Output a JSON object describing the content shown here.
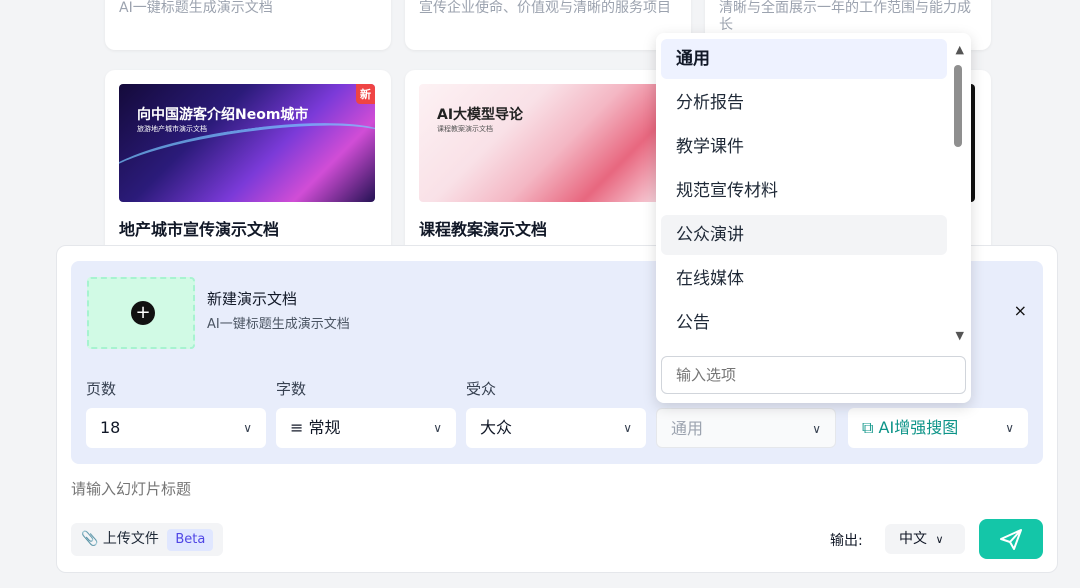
{
  "top_cards": [
    {
      "desc": "AI一键标题生成演示文档"
    },
    {
      "desc": "宣传企业使命、价值观与清晰的服务项目"
    },
    {
      "desc": "清晰与全面展示一年的工作范围与能力成长"
    }
  ],
  "templates": [
    {
      "thumb_title": "向中国游客介绍Neom城市",
      "thumb_sub": "旅游地产城市演示文档",
      "badge": "新",
      "title": "地产城市宣传演示文档"
    },
    {
      "thumb_title": "AI大模型导论",
      "thumb_sub": "课程教案演示文档",
      "title": "课程教案演示文档"
    }
  ],
  "composer": {
    "newdoc_title": "新建演示文档",
    "newdoc_sub": "AI一键标题生成演示文档",
    "close": "×",
    "fields": {
      "pages_label": "页数",
      "pages_value": "18",
      "words_label": "字数",
      "words_value": "≡ 常规",
      "audience_label": "受众",
      "audience_value": "大众",
      "scene_value": "通用",
      "ai_value": "AI增强搜图"
    },
    "title_placeholder": "请输入幻灯片标题",
    "upload_label": "上传文件",
    "beta": "Beta",
    "output_label": "输出:",
    "lang_value": "中文"
  },
  "dropdown": {
    "options": [
      "通用",
      "分析报告",
      "教学课件",
      "规范宣传材料",
      "公众演讲",
      "在线媒体",
      "公告"
    ],
    "input_placeholder": "输入选项"
  },
  "colors": {
    "accent": "#14c6a8",
    "panel": "#e8edfb",
    "badge": "#ef4444"
  }
}
